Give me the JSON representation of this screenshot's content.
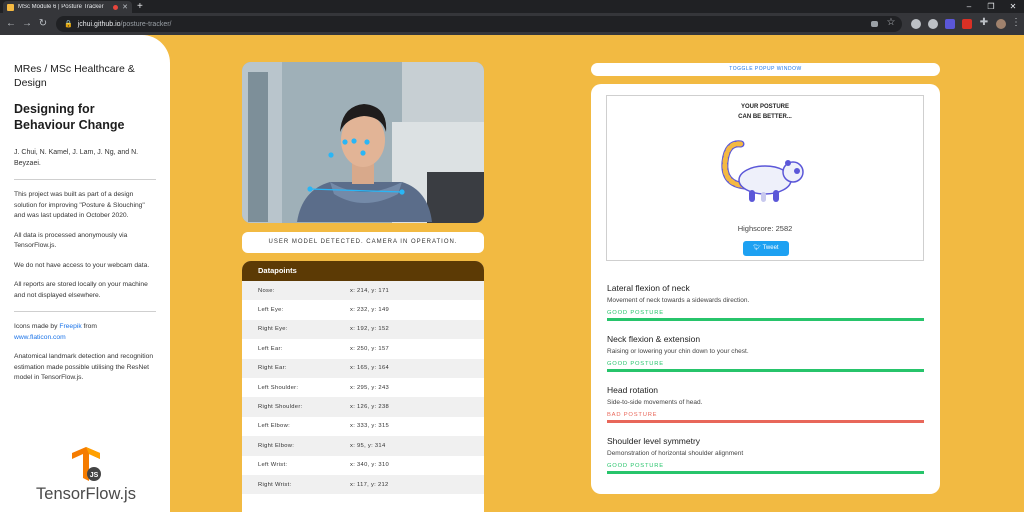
{
  "browser": {
    "tab_title": "MSc Module 6 | Posture Tracker",
    "url_host": "jchui.github.io",
    "url_path": "/posture-tracker/",
    "new_tab": "+"
  },
  "sidebar": {
    "course": "MRes / MSc Healthcare & Design",
    "title": "Designing for Behaviour Change",
    "authors": "J. Chui, N. Kamel, J. Lam, J. Ng, and N. Beyzaei.",
    "para1": "This project was built as part of a design solution for improving \"Posture & Slouching\" and was last updated in October 2020.",
    "para2": "All data is processed anonymously via TensorFlow.js.",
    "para3": "We do not have access to your webcam data.",
    "para4": "All reports are stored locally on your machine and not displayed elsewhere.",
    "icons_prefix": "Icons made by ",
    "icons_author": "Freepik",
    "icons_mid": " from ",
    "icons_site": "www.flaticon.com",
    "para6": "Anatomical landmark detection and recognition estimation made possible utilising the ResNet model in TensorFlow.js.",
    "logo_badge": "JS",
    "logo_text": "TensorFlow.js"
  },
  "camera": {
    "status": "USER MODEL DETECTED. CAMERA IN OPERATION."
  },
  "datapoints": {
    "heading": "Datapoints",
    "rows": [
      {
        "label": "Nose:",
        "value": "x: 214, y: 171"
      },
      {
        "label": "Left Eye:",
        "value": "x: 232, y: 149"
      },
      {
        "label": "Right Eye:",
        "value": "x: 192, y: 152"
      },
      {
        "label": "Left Ear:",
        "value": "x: 250, y: 157"
      },
      {
        "label": "Right Ear:",
        "value": "x: 165, y: 164"
      },
      {
        "label": "Left Shoulder:",
        "value": "x: 295, y: 243"
      },
      {
        "label": "Right Shoulder:",
        "value": "x: 126, y: 238"
      },
      {
        "label": "Left Elbow:",
        "value": "x: 333, y: 315"
      },
      {
        "label": "Right Elbow:",
        "value": "x: 95, y: 314"
      },
      {
        "label": "Left Wrist:",
        "value": "x: 340, y: 310"
      },
      {
        "label": "Right Wrist:",
        "value": "x: 117, y: 212"
      }
    ]
  },
  "panel": {
    "toggle_label": "TOGGLE POPUP WINDOW",
    "card_title": "YOUR POSTURE\nCAN BE BETTER...",
    "highscore": "Highscore: 2582",
    "tweet": "Tweet",
    "metrics": [
      {
        "title": "Lateral flexion of neck",
        "desc": "Movement of neck towards a sidewards direction.",
        "status": "GOOD POSTURE",
        "good": true
      },
      {
        "title": "Neck flexion & extension",
        "desc": "Raising or lowering your chin down to your chest.",
        "status": "GOOD POSTURE",
        "good": true
      },
      {
        "title": "Head rotation",
        "desc": "Side-to-side movements of head.",
        "status": "BAD POSTURE",
        "good": false
      },
      {
        "title": "Shoulder level symmetry",
        "desc": "Demonstration of horizontal shoulder alignment",
        "status": "GOOD POSTURE",
        "good": true
      }
    ]
  },
  "colors": {
    "accent": "#f2ba42",
    "good": "#27c46b",
    "bad": "#e8675a",
    "table_header": "#5c3a05"
  }
}
